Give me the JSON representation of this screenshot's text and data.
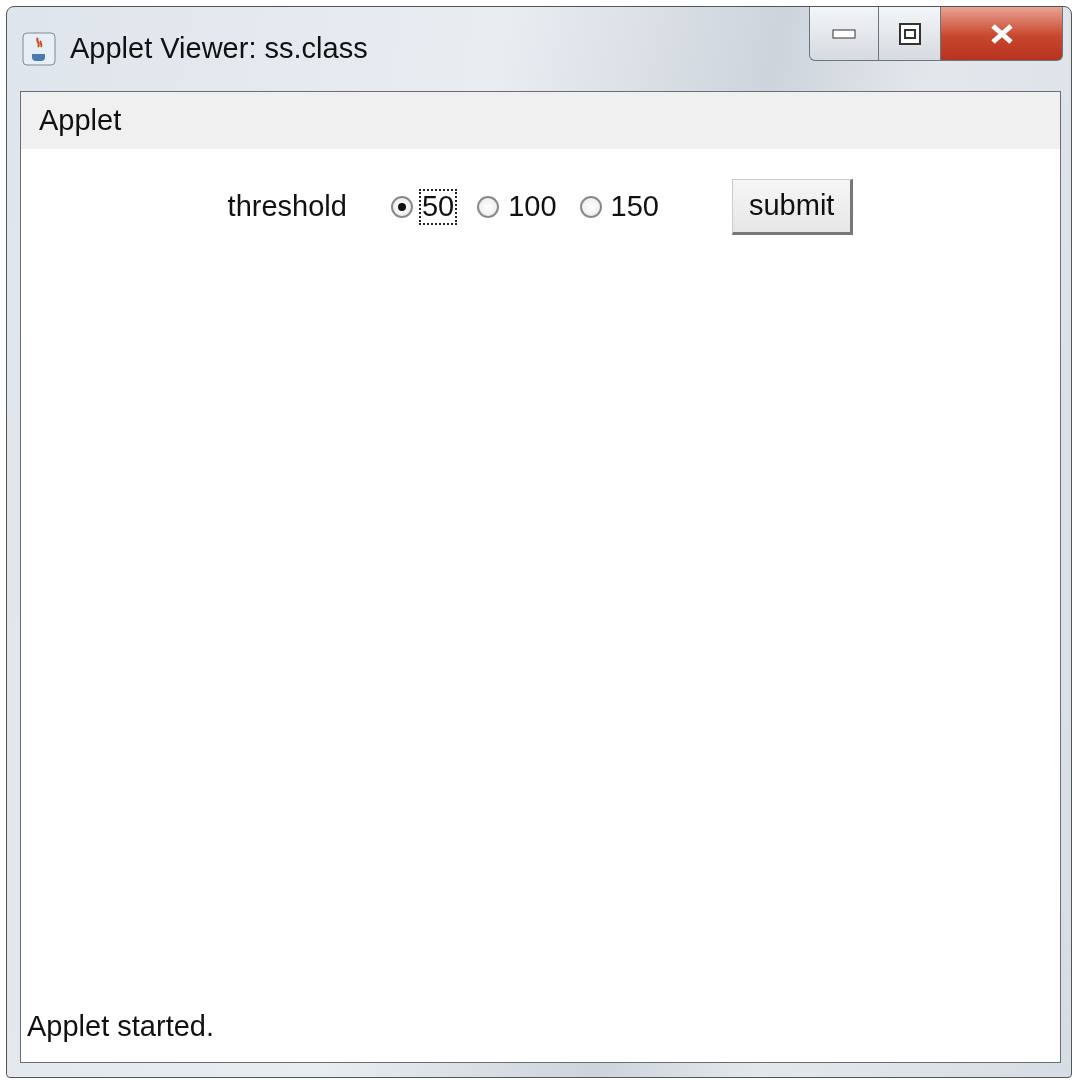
{
  "window": {
    "title": "Applet Viewer: ss.class"
  },
  "menu": [
    {
      "label": "Applet"
    }
  ],
  "form": {
    "label": "threshold",
    "options": [
      {
        "label": "50",
        "selected": true,
        "focused": true
      },
      {
        "label": "100",
        "selected": false,
        "focused": false
      },
      {
        "label": "150",
        "selected": false,
        "focused": false
      }
    ],
    "button": "submit"
  },
  "status_bar": "Applet started."
}
